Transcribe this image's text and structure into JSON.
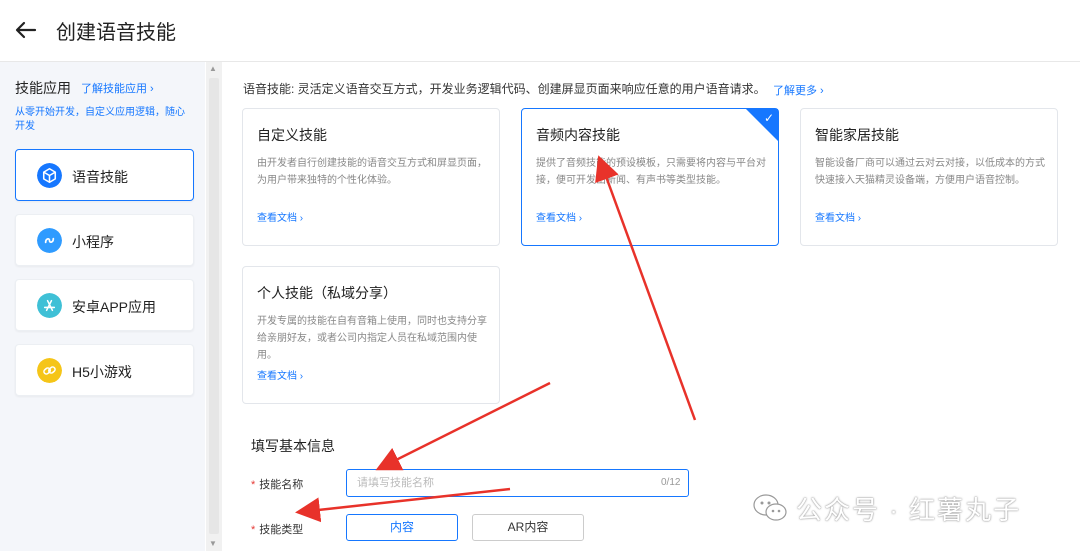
{
  "header": {
    "title": "创建语音技能"
  },
  "sidebar": {
    "heading": "技能应用",
    "learn_link": "了解技能应用 ›",
    "description": "从零开始开发，自定义应用逻辑，随心开发",
    "items": [
      {
        "label": "语音技能",
        "icon": "cube-icon",
        "color": "#1677ff",
        "active": true
      },
      {
        "label": "小程序",
        "icon": "link-icon",
        "color": "#2f9bff",
        "active": false
      },
      {
        "label": "安卓APP应用",
        "icon": "appstore-icon",
        "color": "#3fc0d6",
        "active": false
      },
      {
        "label": "H5小游戏",
        "icon": "chain-icon",
        "color": "#f5c518",
        "active": false
      }
    ]
  },
  "main": {
    "intro": "语音技能: 灵活定义语音交互方式，开发业务逻辑代码、创建屏显页面来响应任意的用户语音请求。",
    "intro_link": "了解更多 ›",
    "cards": [
      {
        "title": "自定义技能",
        "desc": "由开发者自行创建技能的语音交互方式和屏显页面，为用户带来独特的个性化体验。",
        "link": "查看文档 ›",
        "selected": false
      },
      {
        "title": "音频内容技能",
        "desc": "提供了音频技能的预设模板，只需要将内容与平台对接，便可开发出新闻、有声书等类型技能。",
        "link": "查看文档 ›",
        "selected": true
      },
      {
        "title": "智能家居技能",
        "desc": "智能设备厂商可以通过云对云对接，以低成本的方式快速接入天猫精灵设备端，方便用户语音控制。",
        "link": "查看文档 ›",
        "selected": false
      },
      {
        "title": "个人技能（私域分享）",
        "desc": "开发专属的技能在自有音箱上使用，同时也支持分享给亲朋好友，或者公司内指定人员在私域范围内使用。",
        "link": "查看文档 ›",
        "selected": false
      }
    ],
    "check_mark": "✓"
  },
  "form": {
    "title": "填写基本信息",
    "required_mark": "*",
    "name_label": "技能名称",
    "name_placeholder": "请填写技能名称",
    "name_value": "",
    "name_counter": "0/12",
    "type_label": "技能类型",
    "type_options": [
      "内容",
      "AR内容"
    ],
    "type_selected": "内容"
  },
  "watermark": {
    "text": "公众号 · 红薯丸子"
  },
  "colors": {
    "accent": "#1677ff",
    "arrow": "#e8322a",
    "sidebar_bg": "#f4f6fa"
  }
}
